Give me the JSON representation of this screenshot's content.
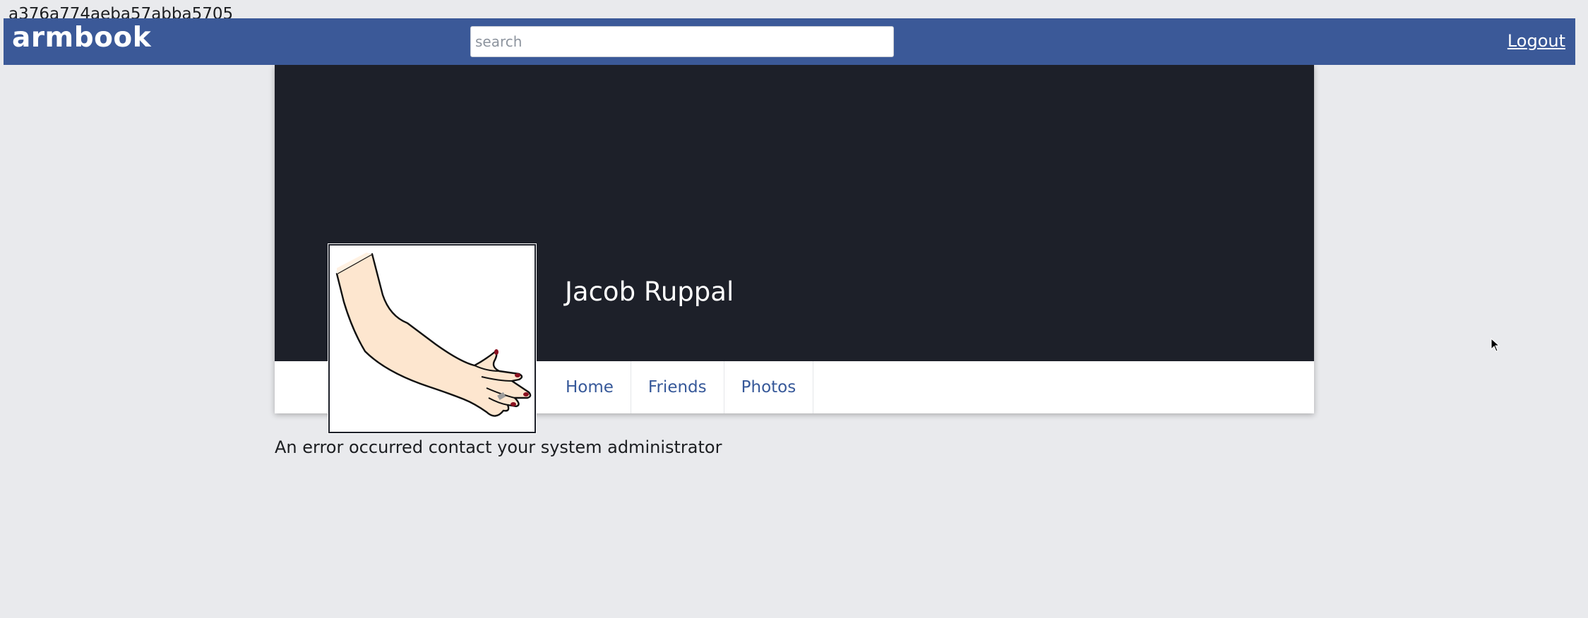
{
  "page": {
    "hash_text": "a376a774aeba57abba5705"
  },
  "header": {
    "brand": "armbook",
    "search_placeholder": "search",
    "search_value": "",
    "logout_label": "Logout",
    "color": "#3b5998"
  },
  "profile": {
    "name": "Jacob Ruppal",
    "avatar_icon": "arm-hand-icon",
    "cover_color": "#1d2029"
  },
  "nav": {
    "tabs": [
      {
        "label": "Home"
      },
      {
        "label": "Friends"
      },
      {
        "label": "Photos"
      }
    ]
  },
  "error": {
    "message": "An error occurred contact your system administrator"
  }
}
